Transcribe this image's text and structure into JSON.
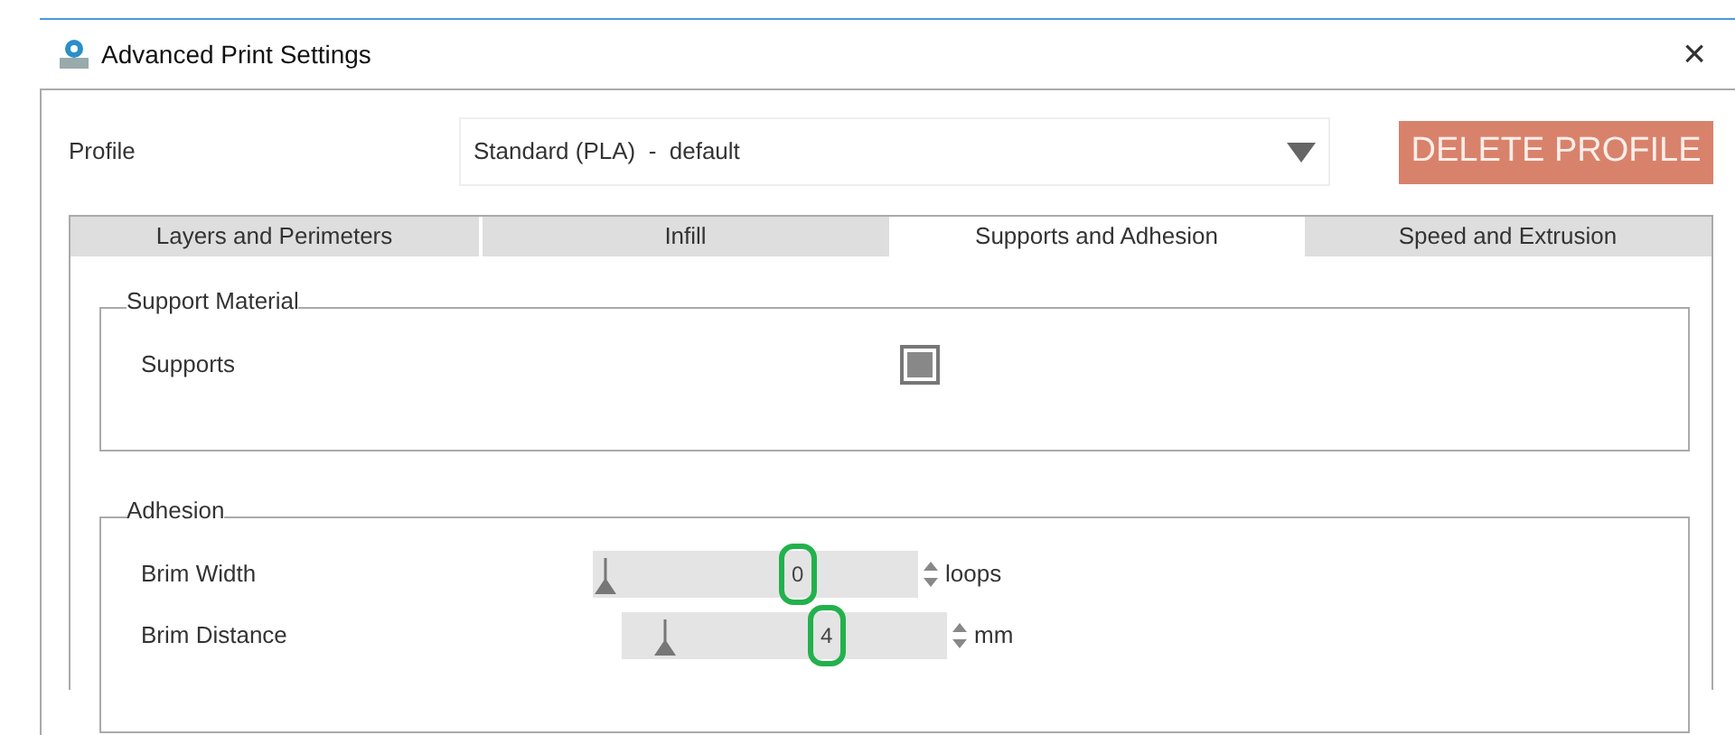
{
  "window": {
    "title": "Advanced Print Settings",
    "close": "×"
  },
  "profile": {
    "label": "Profile",
    "value": "Standard (PLA)  -  default",
    "delete_button": {
      "label": "DELETE PROFILE",
      "disabled": true
    }
  },
  "tabs": [
    {
      "label": "Layers and Perimeters",
      "selected": false
    },
    {
      "label": "Infill",
      "selected": false
    },
    {
      "label": "Supports and Adhesion",
      "selected": true
    },
    {
      "label": "Speed and Extrusion",
      "selected": false
    }
  ],
  "groups": [
    {
      "title": "Support Material",
      "rows": [
        {
          "kind": "checkbox",
          "label": "Supports",
          "checked": true
        }
      ]
    },
    {
      "title": "Adhesion",
      "rows": [
        {
          "kind": "slider",
          "label": "Brim Width",
          "level": 0,
          "value": "0",
          "unit": "loops",
          "highlighted": true
        },
        {
          "kind": "slider",
          "label": "Brim Distance",
          "level": 0.2,
          "value": "4",
          "unit": "mm",
          "highlighted": true
        }
      ]
    }
  ]
}
